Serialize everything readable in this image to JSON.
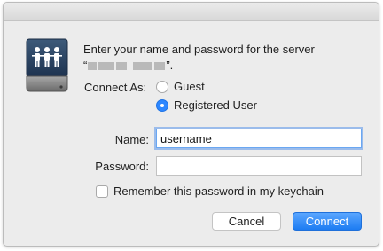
{
  "dialog": {
    "prompt_line1": "Enter your name and password for the server",
    "server_open_quote": "“",
    "server_close_quote": "”.",
    "connect_as_label": "Connect As:",
    "options": [
      {
        "label": "Guest",
        "selected": false
      },
      {
        "label": "Registered User",
        "selected": true
      }
    ],
    "name_label": "Name:",
    "name_value": "username",
    "password_label": "Password:",
    "password_value": "",
    "remember_label": "Remember this password in my keychain",
    "remember_checked": false,
    "cancel_label": "Cancel",
    "connect_label": "Connect"
  },
  "colors": {
    "accent": "#2d87ff",
    "window_bg": "#ececec"
  },
  "icons": {
    "server": "shared-server-icon"
  }
}
